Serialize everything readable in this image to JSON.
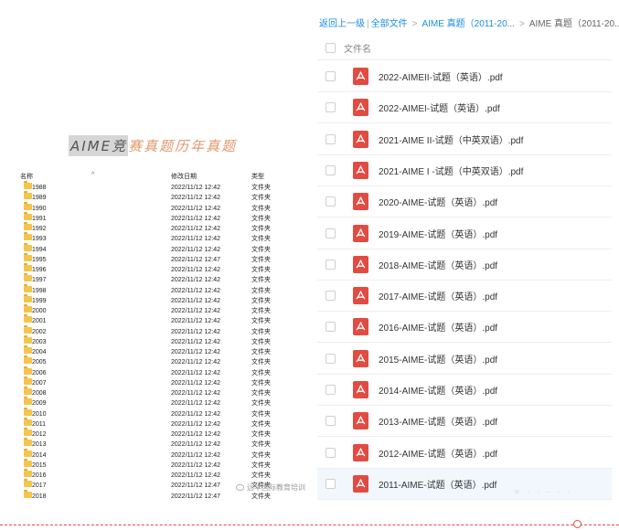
{
  "banner": {
    "highlight": "AIME竞",
    "rest": "赛真题历年真题"
  },
  "explorer": {
    "headers": {
      "name": "名称",
      "modified": "修改日期",
      "type": "类型"
    },
    "sort_indicator": "^",
    "rows": [
      {
        "name": "1988",
        "date": "2022/11/12 12:42",
        "type": "文件夹"
      },
      {
        "name": "1989",
        "date": "2022/11/12 12:42",
        "type": "文件夹"
      },
      {
        "name": "1990",
        "date": "2022/11/12 12:42",
        "type": "文件夹"
      },
      {
        "name": "1991",
        "date": "2022/11/12 12:42",
        "type": "文件夹"
      },
      {
        "name": "1992",
        "date": "2022/11/12 12:42",
        "type": "文件夹"
      },
      {
        "name": "1993",
        "date": "2022/11/12 12:42",
        "type": "文件夹"
      },
      {
        "name": "1994",
        "date": "2022/11/12 12:42",
        "type": "文件夹"
      },
      {
        "name": "1995",
        "date": "2022/11/12 12:47",
        "type": "文件夹"
      },
      {
        "name": "1996",
        "date": "2022/11/12 12:42",
        "type": "文件夹"
      },
      {
        "name": "1997",
        "date": "2022/11/12 12:42",
        "type": "文件夹"
      },
      {
        "name": "1998",
        "date": "2022/11/12 12:42",
        "type": "文件夹"
      },
      {
        "name": "1999",
        "date": "2022/11/12 12:42",
        "type": "文件夹"
      },
      {
        "name": "2000",
        "date": "2022/11/12 12:42",
        "type": "文件夹"
      },
      {
        "name": "2001",
        "date": "2022/11/12 12:42",
        "type": "文件夹"
      },
      {
        "name": "2002",
        "date": "2022/11/12 12:42",
        "type": "文件夹"
      },
      {
        "name": "2003",
        "date": "2022/11/12 12:42",
        "type": "文件夹"
      },
      {
        "name": "2004",
        "date": "2022/11/12 12:42",
        "type": "文件夹"
      },
      {
        "name": "2005",
        "date": "2022/11/12 12:42",
        "type": "文件夹"
      },
      {
        "name": "2006",
        "date": "2022/11/12 12:42",
        "type": "文件夹"
      },
      {
        "name": "2007",
        "date": "2022/11/12 12:42",
        "type": "文件夹"
      },
      {
        "name": "2008",
        "date": "2022/11/12 12:42",
        "type": "文件夹"
      },
      {
        "name": "2009",
        "date": "2022/11/12 12:42",
        "type": "文件夹"
      },
      {
        "name": "2010",
        "date": "2022/11/12 12:42",
        "type": "文件夹"
      },
      {
        "name": "2011",
        "date": "2022/11/12 12:42",
        "type": "文件夹"
      },
      {
        "name": "2012",
        "date": "2022/11/12 12:42",
        "type": "文件夹"
      },
      {
        "name": "2013",
        "date": "2022/11/12 12:42",
        "type": "文件夹"
      },
      {
        "name": "2014",
        "date": "2022/11/12 12:42",
        "type": "文件夹"
      },
      {
        "name": "2015",
        "date": "2022/11/12 12:42",
        "type": "文件夹"
      },
      {
        "name": "2016",
        "date": "2022/11/12 12:42",
        "type": "文件夹"
      },
      {
        "name": "2017",
        "date": "2022/11/12 12:47",
        "type": "文件夹"
      },
      {
        "name": "2018",
        "date": "2022/11/12 12:47",
        "type": "文件夹"
      }
    ]
  },
  "drive": {
    "breadcrumb": {
      "back": "返回上一级",
      "divider": "|",
      "all_files": "全部文件",
      "arrow": ">",
      "parent": "AIME 真题（2011-20...",
      "current": "AIME 真题（2011-20..."
    },
    "column_header": "文件名",
    "files": [
      {
        "name": "2022-AIMEII-试题（英语）.pdf"
      },
      {
        "name": "2022-AIMEI-试题（英语）.pdf"
      },
      {
        "name": "2021-AIME II-试题（中英双语）.pdf"
      },
      {
        "name": "2021-AIME I -试题（中英双语）.pdf"
      },
      {
        "name": "2020-AIME-试题（英语）.pdf"
      },
      {
        "name": "2019-AIME-试题（英语）.pdf"
      },
      {
        "name": "2018-AIME-试题（英语）.pdf"
      },
      {
        "name": "2017-AIME-试题（英语）.pdf"
      },
      {
        "name": "2016-AIME-试题（英语）.pdf"
      },
      {
        "name": "2015-AIME-试题（英语）.pdf"
      },
      {
        "name": "2014-AIME-试题（英语）.pdf"
      },
      {
        "name": "2013-AIME-试题（英语）.pdf"
      },
      {
        "name": "2012-AIME-试题（英语）.pdf"
      },
      {
        "name": "2011-AIME-试题（英语）.pdf",
        "selected": true
      }
    ]
  },
  "watermark": "远华国际教育培训",
  "colors": {
    "link": "#1a8fe0",
    "pdf_red": "#e24b42",
    "folder_yellow": "#f4c54e",
    "banner_orange": "#e0986b",
    "selected_row": "#f1f7fd"
  }
}
